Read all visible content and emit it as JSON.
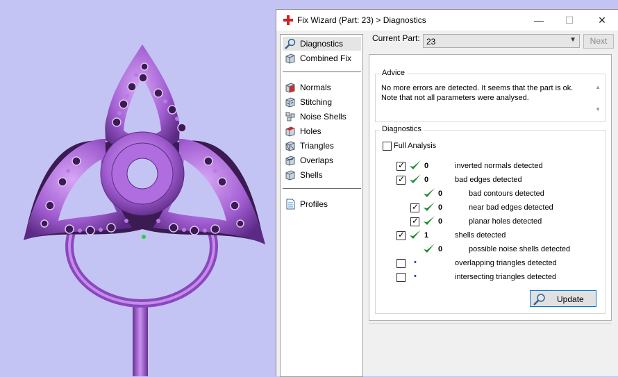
{
  "window": {
    "title": "Fix Wizard (Part: 23) > Diagnostics",
    "controls": {
      "minimize": "—",
      "maximize": "☐",
      "close": "✕"
    }
  },
  "nav": {
    "top": [
      {
        "name": "diagnostics",
        "label": "Diagnostics",
        "icon": "magnifier-icon",
        "active": true
      },
      {
        "name": "combined-fix",
        "label": "Combined Fix",
        "icon": "cube-icon"
      }
    ],
    "fix": [
      {
        "name": "normals",
        "label": "Normals",
        "icon": "normals-cube-icon"
      },
      {
        "name": "stitching",
        "label": "Stitching",
        "icon": "stitching-cube-icon"
      },
      {
        "name": "noise-shells",
        "label": "Noise Shells",
        "icon": "noise-shells-icon"
      },
      {
        "name": "holes",
        "label": "Holes",
        "icon": "holes-cube-icon"
      },
      {
        "name": "triangles",
        "label": "Triangles",
        "icon": "triangles-cube-icon"
      },
      {
        "name": "overlaps",
        "label": "Overlaps",
        "icon": "overlaps-cube-icon"
      },
      {
        "name": "shells",
        "label": "Shells",
        "icon": "shells-cube-icon"
      }
    ],
    "bottom": [
      {
        "name": "profiles",
        "label": "Profiles",
        "icon": "document-icon"
      }
    ]
  },
  "part": {
    "label": "Current Part:",
    "value": "23",
    "next_label": "Next"
  },
  "advice": {
    "title": "Advice",
    "text": "No more errors are detected. It seems that the part is ok. Note that not all parameters were analysed."
  },
  "diagnostics": {
    "title": "Diagnostics",
    "full_analysis_label": "Full Analysis",
    "full_analysis_checked": false,
    "rows": [
      {
        "label": "inverted normals detected",
        "count": "0",
        "checked": true,
        "status": "ok",
        "indent": 0
      },
      {
        "label": "bad edges detected",
        "count": "0",
        "checked": true,
        "status": "ok",
        "indent": 0
      },
      {
        "label": "bad contours detected",
        "count": "0",
        "checkbox": false,
        "status": "ok",
        "indent": 1
      },
      {
        "label": "near bad edges detected",
        "count": "0",
        "checked": true,
        "status": "ok",
        "indent": 1
      },
      {
        "label": "planar holes detected",
        "count": "0",
        "checked": true,
        "status": "ok",
        "indent": 1
      },
      {
        "label": "shells detected",
        "count": "1",
        "checked": true,
        "status": "ok",
        "indent": 0
      },
      {
        "label": "possible noise shells detected",
        "count": "0",
        "checkbox": false,
        "status": "ok",
        "indent": 1
      },
      {
        "label": "overlapping triangles detected",
        "count": "",
        "checked": false,
        "status": "pending",
        "indent": 0
      },
      {
        "label": "intersecting triangles detected",
        "count": "",
        "checked": false,
        "status": "pending",
        "indent": 0
      }
    ],
    "update_label": "Update"
  },
  "colors": {
    "viewport_bg": "#c4c4f4",
    "model": "#a25ed2",
    "check_green": "#1e8c2e",
    "accent": "#0078d7"
  }
}
